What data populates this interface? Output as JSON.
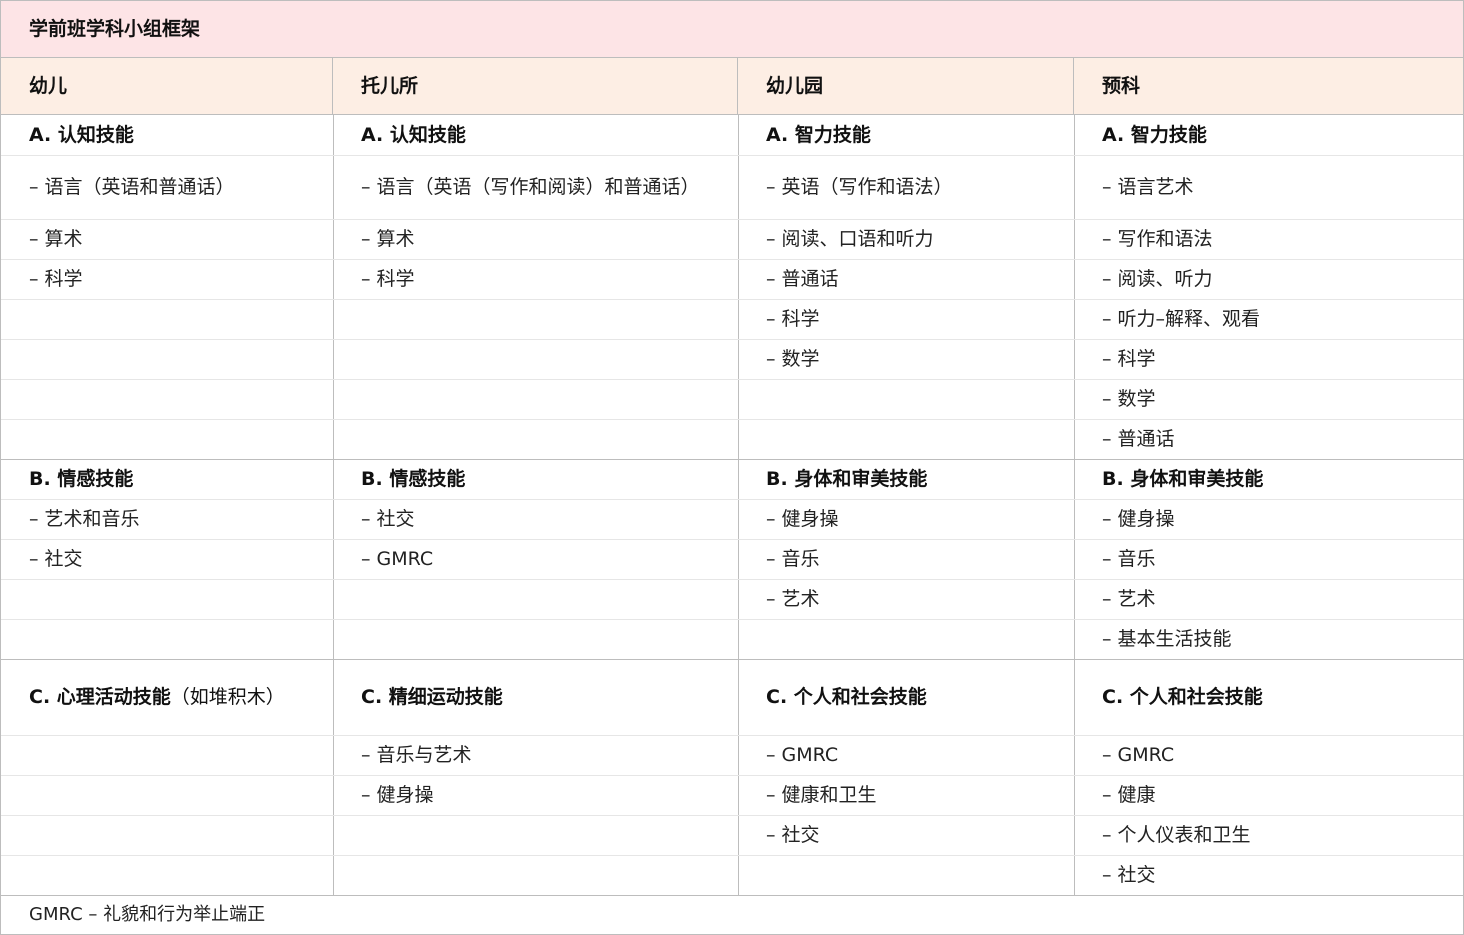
{
  "title": "学前班学科小组框架",
  "columns": [
    "幼儿",
    "托儿所",
    "幼儿园",
    "预科"
  ],
  "sections": {
    "A": {
      "headings": [
        "A. 认知技能",
        "A. 认知技能",
        "A. 智力技能",
        "A. 智力技能"
      ],
      "items": [
        [
          "– 语言（英语和普通话）",
          "– 算术",
          "– 科学"
        ],
        [
          "– 语言（英语（写作和阅读）和普通话）",
          "– 算术",
          "– 科学"
        ],
        [
          "– 英语（写作和语法）",
          "– 阅读、口语和听力",
          "– 普通话",
          "– 科学",
          "– 数学"
        ],
        [
          "– 语言艺术",
          "– 写作和语法",
          "– 阅读、听力",
          "– 听力–解释、观看",
          "– 科学",
          "– 数学",
          "– 普通话"
        ]
      ]
    },
    "B": {
      "headings": [
        "B. 情感技能",
        "B. 情感技能",
        "B. 身体和审美技能",
        "B. 身体和审美技能"
      ],
      "items": [
        [
          "– 艺术和音乐",
          "– 社交"
        ],
        [
          "– 社交",
          "– GMRC"
        ],
        [
          "– 健身操",
          "– 音乐",
          "– 艺术"
        ],
        [
          "– 健身操",
          "– 音乐",
          "– 艺术",
          "– 基本生活技能"
        ]
      ]
    },
    "C": {
      "headings": [
        "C. 心理活动技能",
        "C. 精细运动技能",
        "C. 个人和社会技能",
        "C. 个人和社会技能"
      ],
      "heading_note": "（如堆积木）",
      "items": [
        [],
        [
          "– 音乐与艺术",
          "– 健身操"
        ],
        [
          "– GMRC",
          "– 健康和卫生",
          "– 社交"
        ],
        [
          "– GMRC",
          "– 健康",
          "– 个人仪表和卫生",
          "– 社交"
        ]
      ]
    }
  },
  "footer": "GMRC – 礼貌和行为举止端正"
}
